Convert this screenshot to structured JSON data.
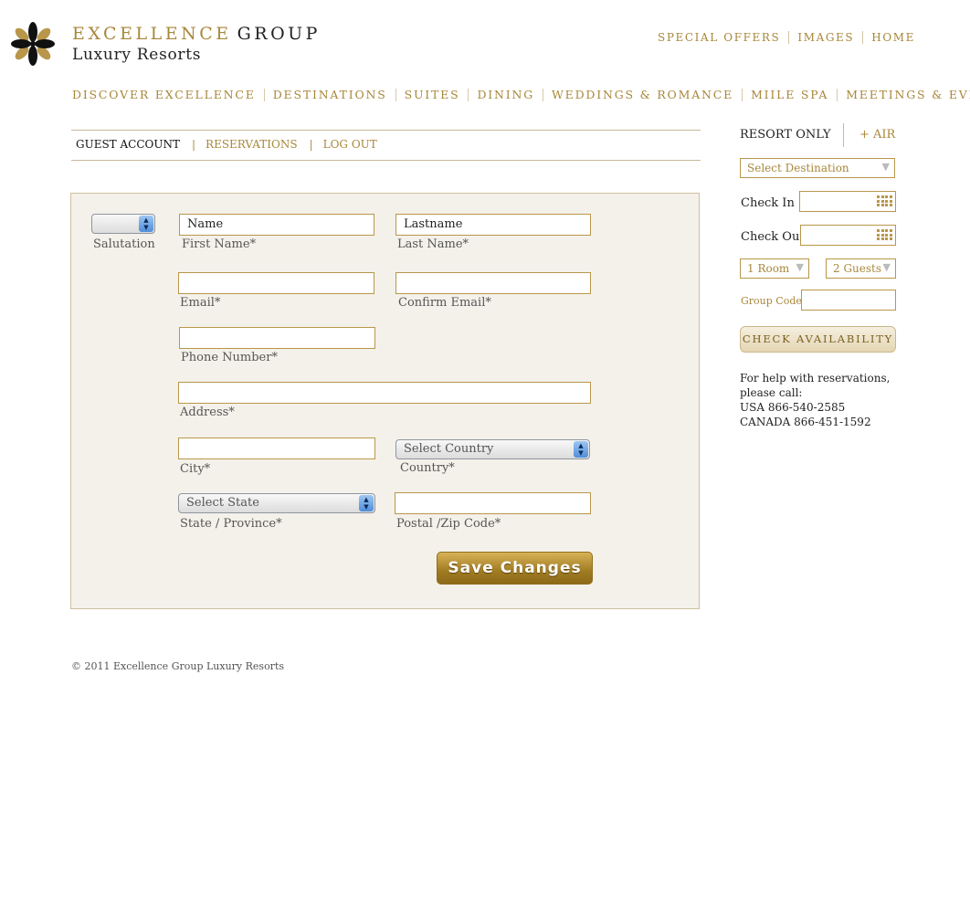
{
  "brand": {
    "line1_word1": "EXCELLENCE",
    "line1_word2": "GROUP",
    "line2": "Luxury Resorts"
  },
  "top_links": [
    "SPECIAL OFFERS",
    "IMAGES",
    "HOME"
  ],
  "main_nav": [
    "DISCOVER EXCELLENCE",
    "DESTINATIONS",
    "SUITES",
    "DINING",
    "WEDDINGS & ROMANCE",
    "MIILE SPA",
    "MEETINGS & EVENTS"
  ],
  "account_nav": {
    "current": "GUEST ACCOUNT",
    "separator": "|",
    "reservations": "RESERVATIONS",
    "logout": "LOG OUT"
  },
  "form": {
    "salutation": {
      "value": "",
      "label": "Salutation"
    },
    "first_name": {
      "value": "Name",
      "label": "First Name*"
    },
    "last_name": {
      "value": "Lastname",
      "label": "Last Name*"
    },
    "email": {
      "value": "",
      "label": "Email*"
    },
    "confirm_email": {
      "value": "",
      "label": "Confirm Email*"
    },
    "phone": {
      "value": "",
      "label": "Phone Number*"
    },
    "address": {
      "value": "",
      "label": "Address*"
    },
    "city": {
      "value": "",
      "label": "City*"
    },
    "country": {
      "value": "Select Country",
      "label": "Country*"
    },
    "state": {
      "value": "Select State",
      "label": "State / Province*"
    },
    "postal": {
      "value": "",
      "label": "Postal /Zip Code*"
    },
    "save_label": "Save Changes"
  },
  "booking": {
    "resort_only": "RESORT ONLY",
    "plus_air": "+ AIR",
    "destination": "Select Destination",
    "check_in_label": "Check In",
    "check_out_label": "Check Out",
    "rooms": "1 Room",
    "guests": "2 Guests",
    "group_code_label": "Group Code",
    "check_availability": "CHECK AVAILABILITY"
  },
  "help": {
    "line1": "For help with reservations,",
    "line2": "please call:",
    "usa": "USA 866-540-2585",
    "canada": "CANADA 866-451-1592"
  },
  "footer": "© 2011 Excellence Group Luxury Resorts",
  "colors": {
    "accent": "#a8873a",
    "panel_bg": "#f4f1ea",
    "border": "#b9974a"
  }
}
